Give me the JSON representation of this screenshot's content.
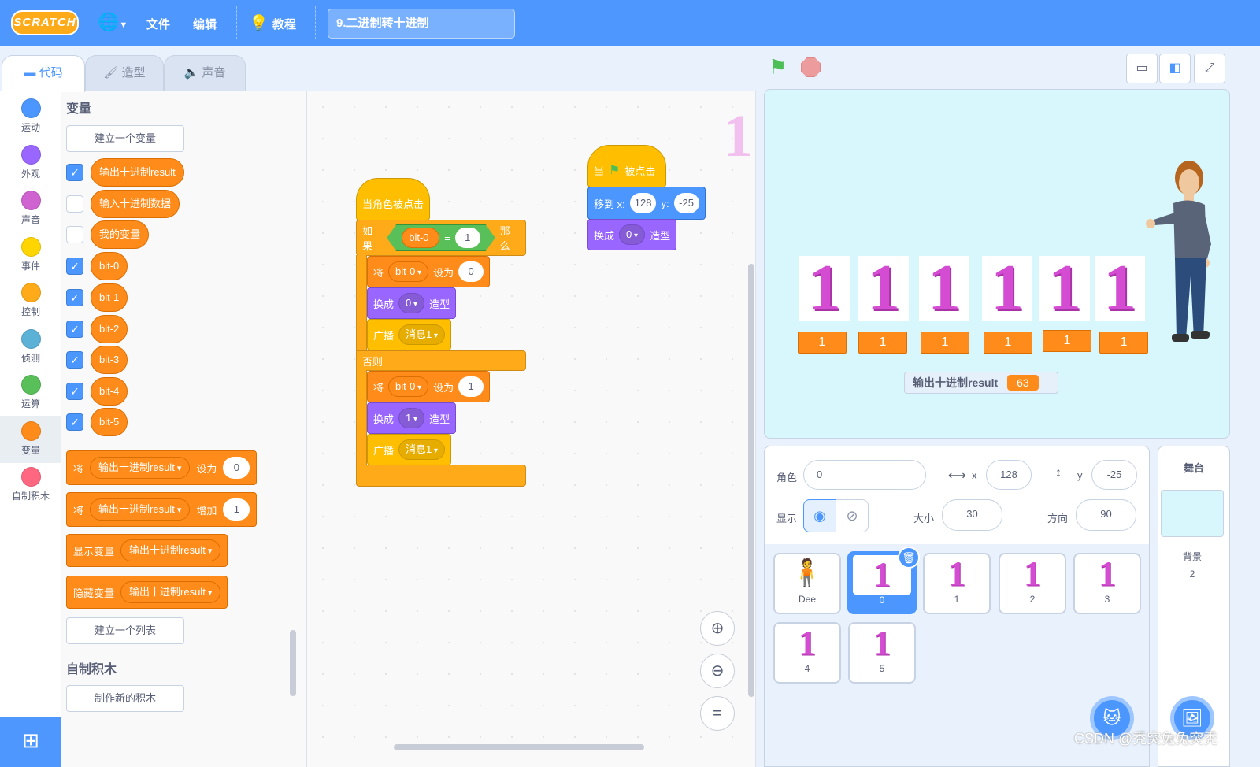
{
  "menubar": {
    "logo": "SCRATCH",
    "file": "文件",
    "edit": "编辑",
    "tutorial": "教程",
    "project_title": "9.二进制转十进制"
  },
  "tabs": [
    {
      "label": "代码"
    },
    {
      "label": "造型"
    },
    {
      "label": "声音"
    }
  ],
  "categories": [
    {
      "label": "运动",
      "color": "#4c97ff"
    },
    {
      "label": "外观",
      "color": "#9966ff"
    },
    {
      "label": "声音",
      "color": "#cf63cf"
    },
    {
      "label": "事件",
      "color": "#ffd500"
    },
    {
      "label": "控制",
      "color": "#ffab19"
    },
    {
      "label": "侦测",
      "color": "#5cb1d6"
    },
    {
      "label": "运算",
      "color": "#59c059"
    },
    {
      "label": "变量",
      "color": "#ff8c1a"
    },
    {
      "label": "自制积木",
      "color": "#ff6680"
    }
  ],
  "palette": {
    "heading": "变量",
    "make_var": "建立一个变量",
    "vars": [
      {
        "name": "输出十进制result",
        "checked": true
      },
      {
        "name": "输入十进制数据",
        "checked": false
      },
      {
        "name": "我的变量",
        "checked": false
      },
      {
        "name": "bit-0",
        "checked": true
      },
      {
        "name": "bit-1",
        "checked": true
      },
      {
        "name": "bit-2",
        "checked": true
      },
      {
        "name": "bit-3",
        "checked": true
      },
      {
        "name": "bit-4",
        "checked": true
      },
      {
        "name": "bit-5",
        "checked": true
      }
    ],
    "set_block": {
      "w1": "将",
      "var": "输出十进制result",
      "w2": "设为",
      "val": "0"
    },
    "change_block": {
      "w1": "将",
      "var": "输出十进制result",
      "w2": "增加",
      "val": "1"
    },
    "show_block": {
      "w1": "显示变量",
      "var": "输出十进制result"
    },
    "hide_block": {
      "w1": "隐藏变量",
      "var": "输出十进制result"
    },
    "make_list": "建立一个列表",
    "custom_heading": "自制积木",
    "make_block": "制作新的积木"
  },
  "code": {
    "hat1": "当角色被点击",
    "if": {
      "w1": "如果",
      "var": "bit-0",
      "op": "=",
      "val": "1",
      "w2": "那么"
    },
    "set0": {
      "w1": "将",
      "var": "bit-0",
      "w2": "设为",
      "val": "0"
    },
    "costume0": {
      "w1": "换成",
      "val": "0",
      "w2": "造型"
    },
    "bc1": {
      "w1": "广播",
      "val": "消息1"
    },
    "else": "否则",
    "set1": {
      "w1": "将",
      "var": "bit-0",
      "w2": "设为",
      "val": "1"
    },
    "costume1": {
      "w1": "换成",
      "val": "1",
      "w2": "造型"
    },
    "bc2": {
      "w1": "广播",
      "val": "消息1"
    },
    "hat2": {
      "w1": "当",
      "w2": "被点击"
    },
    "goto": {
      "w1": "移到 x:",
      "x": "128",
      "w2": "y:",
      "y": "-25"
    },
    "costume2": {
      "w1": "换成",
      "val": "0",
      "w2": "造型"
    },
    "sprite_watermark": "1"
  },
  "stage": {
    "digits": [
      "1",
      "1",
      "1",
      "1",
      "1",
      "1"
    ],
    "monitors": [
      "1",
      "1",
      "1",
      "1",
      "1",
      "1"
    ],
    "result_label": "输出十进制result",
    "result_value": "63"
  },
  "sprite_info": {
    "sprite_label": "角色",
    "sprite_name": "0",
    "x_label": "x",
    "x": "128",
    "y_label": "y",
    "y": "-25",
    "show_label": "显示",
    "size_label": "大小",
    "size": "30",
    "dir_label": "方向",
    "dir": "90"
  },
  "sprites": [
    {
      "name": "Dee",
      "img": "🧍"
    },
    {
      "name": "0",
      "img": "1"
    },
    {
      "name": "1",
      "img": "1"
    },
    {
      "name": "2",
      "img": "1"
    },
    {
      "name": "3",
      "img": "1"
    },
    {
      "name": "4",
      "img": "1"
    },
    {
      "name": "5",
      "img": "1"
    }
  ],
  "stage_panel": {
    "title": "舞台",
    "backdrop_label": "背景",
    "backdrop_count": "2"
  },
  "watermark": "CSDN @秃突兔兔突秃",
  "colors": {
    "accent": "#4d97ff",
    "variables": "#ff8c1a",
    "looks": "#9966ff",
    "events": "#ffbf00",
    "control": "#ffab19"
  }
}
